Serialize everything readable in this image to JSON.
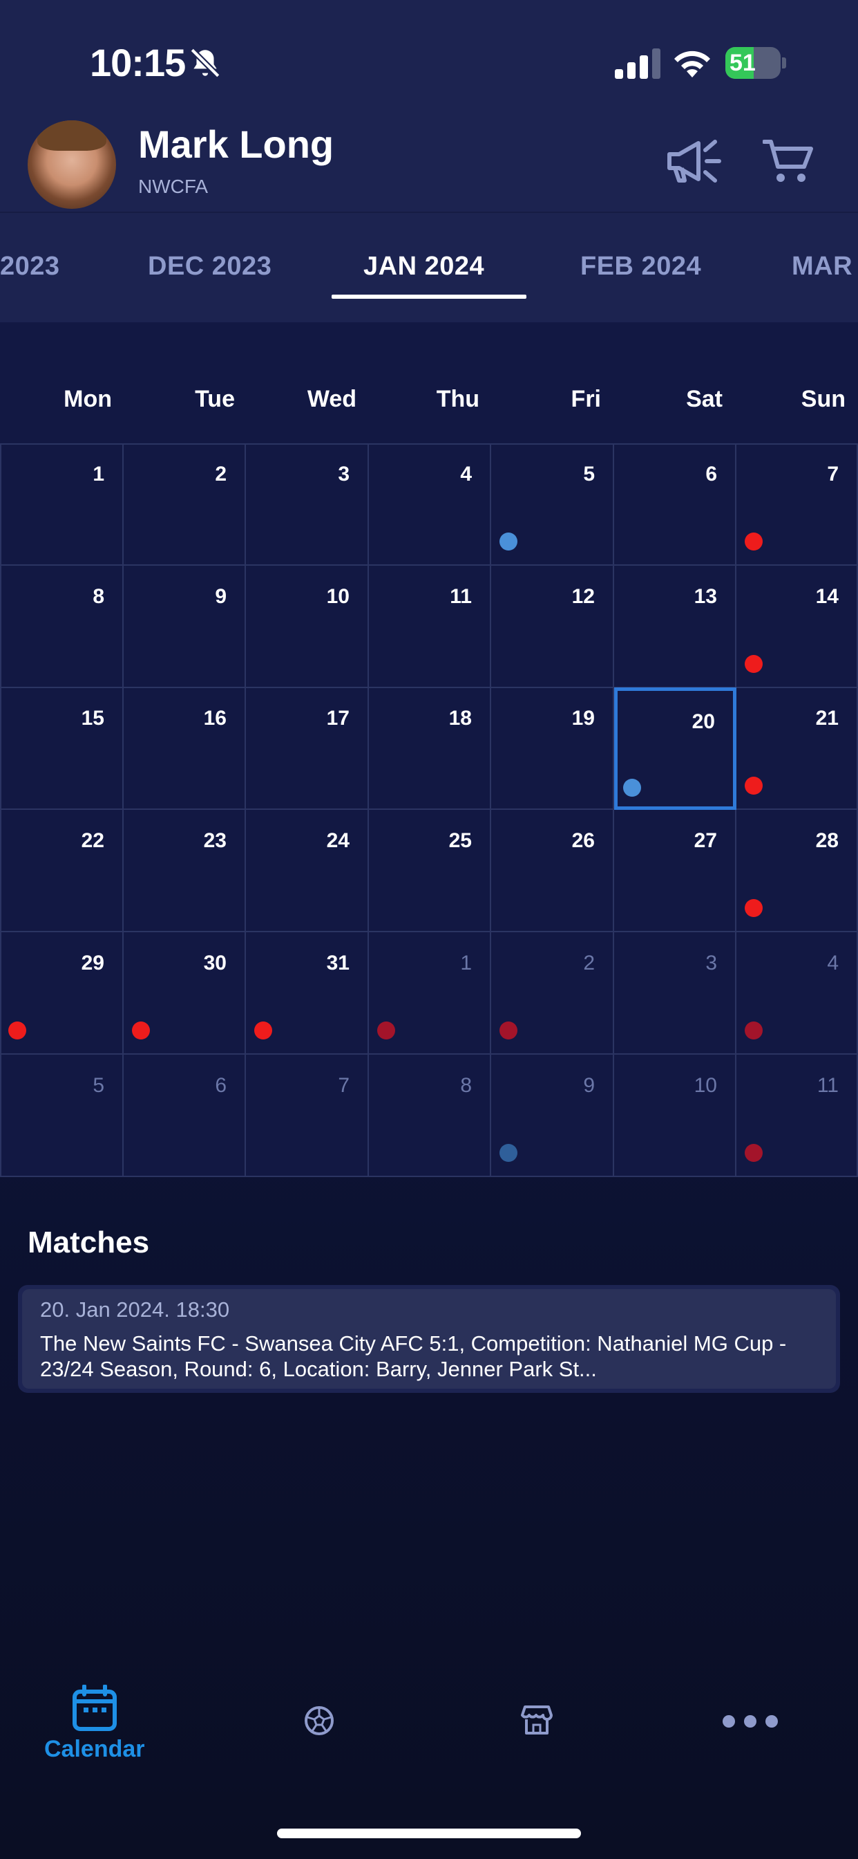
{
  "status_bar": {
    "time": "10:15",
    "battery_level": "51",
    "battery_fraction": 0.51
  },
  "header": {
    "user_name": "Mark Long",
    "organization": "NWCFA"
  },
  "month_tabs": [
    {
      "label": "2023",
      "active": false
    },
    {
      "label": "DEC 2023",
      "active": false
    },
    {
      "label": "JAN 2024",
      "active": true
    },
    {
      "label": "FEB 2024",
      "active": false
    },
    {
      "label": "MAR",
      "active": false
    }
  ],
  "weekdays": [
    "Mon",
    "Tue",
    "Wed",
    "Thu",
    "Fri",
    "Sat",
    "Sun"
  ],
  "calendar": {
    "selected_day": "20",
    "cells": [
      {
        "day": "1",
        "muted": false,
        "dot": null
      },
      {
        "day": "2",
        "muted": false,
        "dot": null
      },
      {
        "day": "3",
        "muted": false,
        "dot": null
      },
      {
        "day": "4",
        "muted": false,
        "dot": null
      },
      {
        "day": "5",
        "muted": false,
        "dot": "blue"
      },
      {
        "day": "6",
        "muted": false,
        "dot": null
      },
      {
        "day": "7",
        "muted": false,
        "dot": "red"
      },
      {
        "day": "8",
        "muted": false,
        "dot": null
      },
      {
        "day": "9",
        "muted": false,
        "dot": null
      },
      {
        "day": "10",
        "muted": false,
        "dot": null
      },
      {
        "day": "11",
        "muted": false,
        "dot": null
      },
      {
        "day": "12",
        "muted": false,
        "dot": null
      },
      {
        "day": "13",
        "muted": false,
        "dot": null
      },
      {
        "day": "14",
        "muted": false,
        "dot": "red"
      },
      {
        "day": "15",
        "muted": false,
        "dot": null
      },
      {
        "day": "16",
        "muted": false,
        "dot": null
      },
      {
        "day": "17",
        "muted": false,
        "dot": null
      },
      {
        "day": "18",
        "muted": false,
        "dot": null
      },
      {
        "day": "19",
        "muted": false,
        "dot": null
      },
      {
        "day": "20",
        "muted": false,
        "dot": "blue"
      },
      {
        "day": "21",
        "muted": false,
        "dot": "red"
      },
      {
        "day": "22",
        "muted": false,
        "dot": null
      },
      {
        "day": "23",
        "muted": false,
        "dot": null
      },
      {
        "day": "24",
        "muted": false,
        "dot": null
      },
      {
        "day": "25",
        "muted": false,
        "dot": null
      },
      {
        "day": "26",
        "muted": false,
        "dot": null
      },
      {
        "day": "27",
        "muted": false,
        "dot": null
      },
      {
        "day": "28",
        "muted": false,
        "dot": "red"
      },
      {
        "day": "29",
        "muted": false,
        "dot": "red"
      },
      {
        "day": "30",
        "muted": false,
        "dot": "red"
      },
      {
        "day": "31",
        "muted": false,
        "dot": "red"
      },
      {
        "day": "1",
        "muted": true,
        "dot": "dark-red"
      },
      {
        "day": "2",
        "muted": true,
        "dot": "dark-red"
      },
      {
        "day": "3",
        "muted": true,
        "dot": null
      },
      {
        "day": "4",
        "muted": true,
        "dot": "dark-red"
      },
      {
        "day": "5",
        "muted": true,
        "dot": null
      },
      {
        "day": "6",
        "muted": true,
        "dot": null
      },
      {
        "day": "7",
        "muted": true,
        "dot": null
      },
      {
        "day": "8",
        "muted": true,
        "dot": null
      },
      {
        "day": "9",
        "muted": true,
        "dot": "dark-blue"
      },
      {
        "day": "10",
        "muted": true,
        "dot": null
      },
      {
        "day": "11",
        "muted": true,
        "dot": "dark-red"
      }
    ]
  },
  "dot_colors": {
    "blue": "#4a90d9",
    "red": "#ee1c1c",
    "dark-red": "#a3142a",
    "dark-blue": "#2f5f9a"
  },
  "matches": {
    "title": "Matches",
    "items": [
      {
        "date": "20. Jan 2024. 18:30",
        "description": "The New Saints FC - Swansea City AFC 5:1, Competition: Nathaniel MG Cup - 23/24 Season, Round: 6, Location: Barry, Jenner Park St..."
      }
    ]
  },
  "bottom_nav": {
    "items": [
      {
        "icon": "calendar-icon",
        "label": "Calendar",
        "active": true
      },
      {
        "icon": "soccer-ball-icon",
        "label": "",
        "active": false
      },
      {
        "icon": "store-icon",
        "label": "",
        "active": false
      },
      {
        "icon": "more-icon",
        "label": "",
        "active": false
      }
    ]
  },
  "colors": {
    "accent": "#1e90e6",
    "selected_border": "#2f7ad9",
    "header_bg": "#1c2350",
    "muted_text": "#8f9bcc"
  }
}
